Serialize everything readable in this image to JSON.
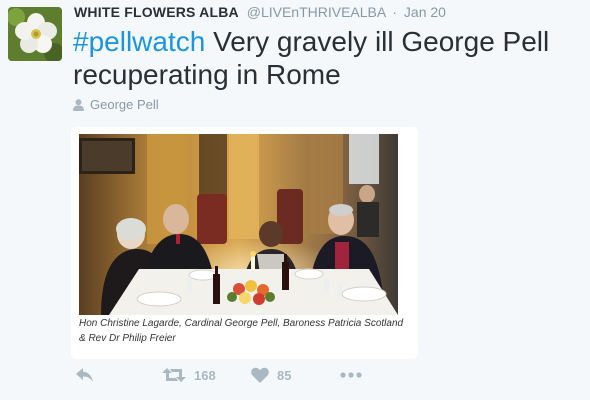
{
  "tweet": {
    "author_name": "WHITE FLOWERS ALBA",
    "handle": "@LIVEnTHRIVEALBA",
    "separator": "·",
    "date": "Jan 20",
    "hashtag": "#pellwatch",
    "text": " Very gravely ill George Pell recuperating in Rome",
    "location": "George Pell",
    "caption": "Hon Christine Lagarde, Cardinal George Pell, Baroness Patricia Scotland & Rev Dr Philip Freier",
    "retweets": "168",
    "likes": "85"
  },
  "icons": {
    "reply": "reply-icon",
    "retweet": "retweet-icon",
    "like": "heart-icon",
    "more": "more-icon",
    "location": "person-icon"
  },
  "colors": {
    "background": "#f5f8fa",
    "hashtag": "#1b95e0",
    "muted": "#8899a6",
    "action": "#aab8c2"
  }
}
